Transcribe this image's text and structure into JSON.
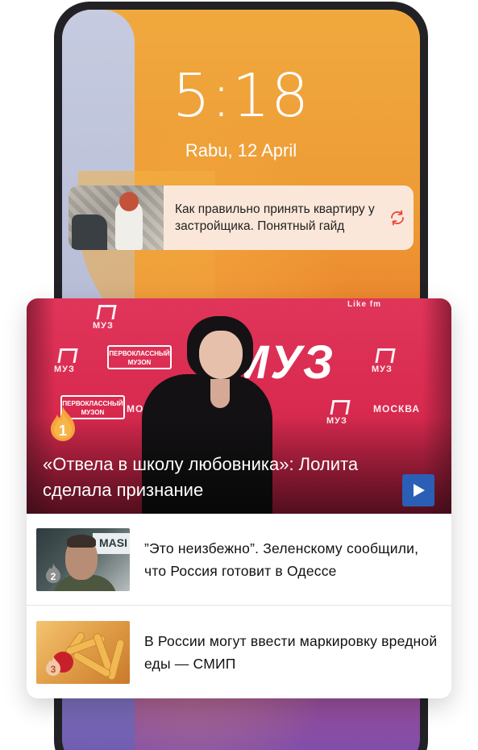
{
  "lockscreen": {
    "time": "5:18",
    "date": "Rabu, 12 April"
  },
  "notification": {
    "text": "Как правильно принять квартиру у застройщика. Понятный гайд",
    "icon": "refresh-icon"
  },
  "top_story": {
    "rank": "1",
    "title": "«Отвела в школу любовника»: Лолита сделала признание",
    "backdrop_logo": "МУЗ",
    "backdrop_badge": "ПЕРВОКЛАССНЫЙ МУЗON",
    "backdrop_moscow": "МОСКВА",
    "backdrop_like": "Like fm",
    "play_icon": "play-icon"
  },
  "stories": [
    {
      "rank": "2",
      "text": "”Это неизбежно”. Зеленскому сообщили, что Россия готовит в Одессе",
      "thumb_sign": "MASI"
    },
    {
      "rank": "3",
      "text": "В России могут ввести маркировку вредной еды — СМИП"
    }
  ],
  "colors": {
    "accent_red": "#d92a4f",
    "play_blue": "#2a5fb5",
    "notification_bg": "#fbe7d9"
  }
}
